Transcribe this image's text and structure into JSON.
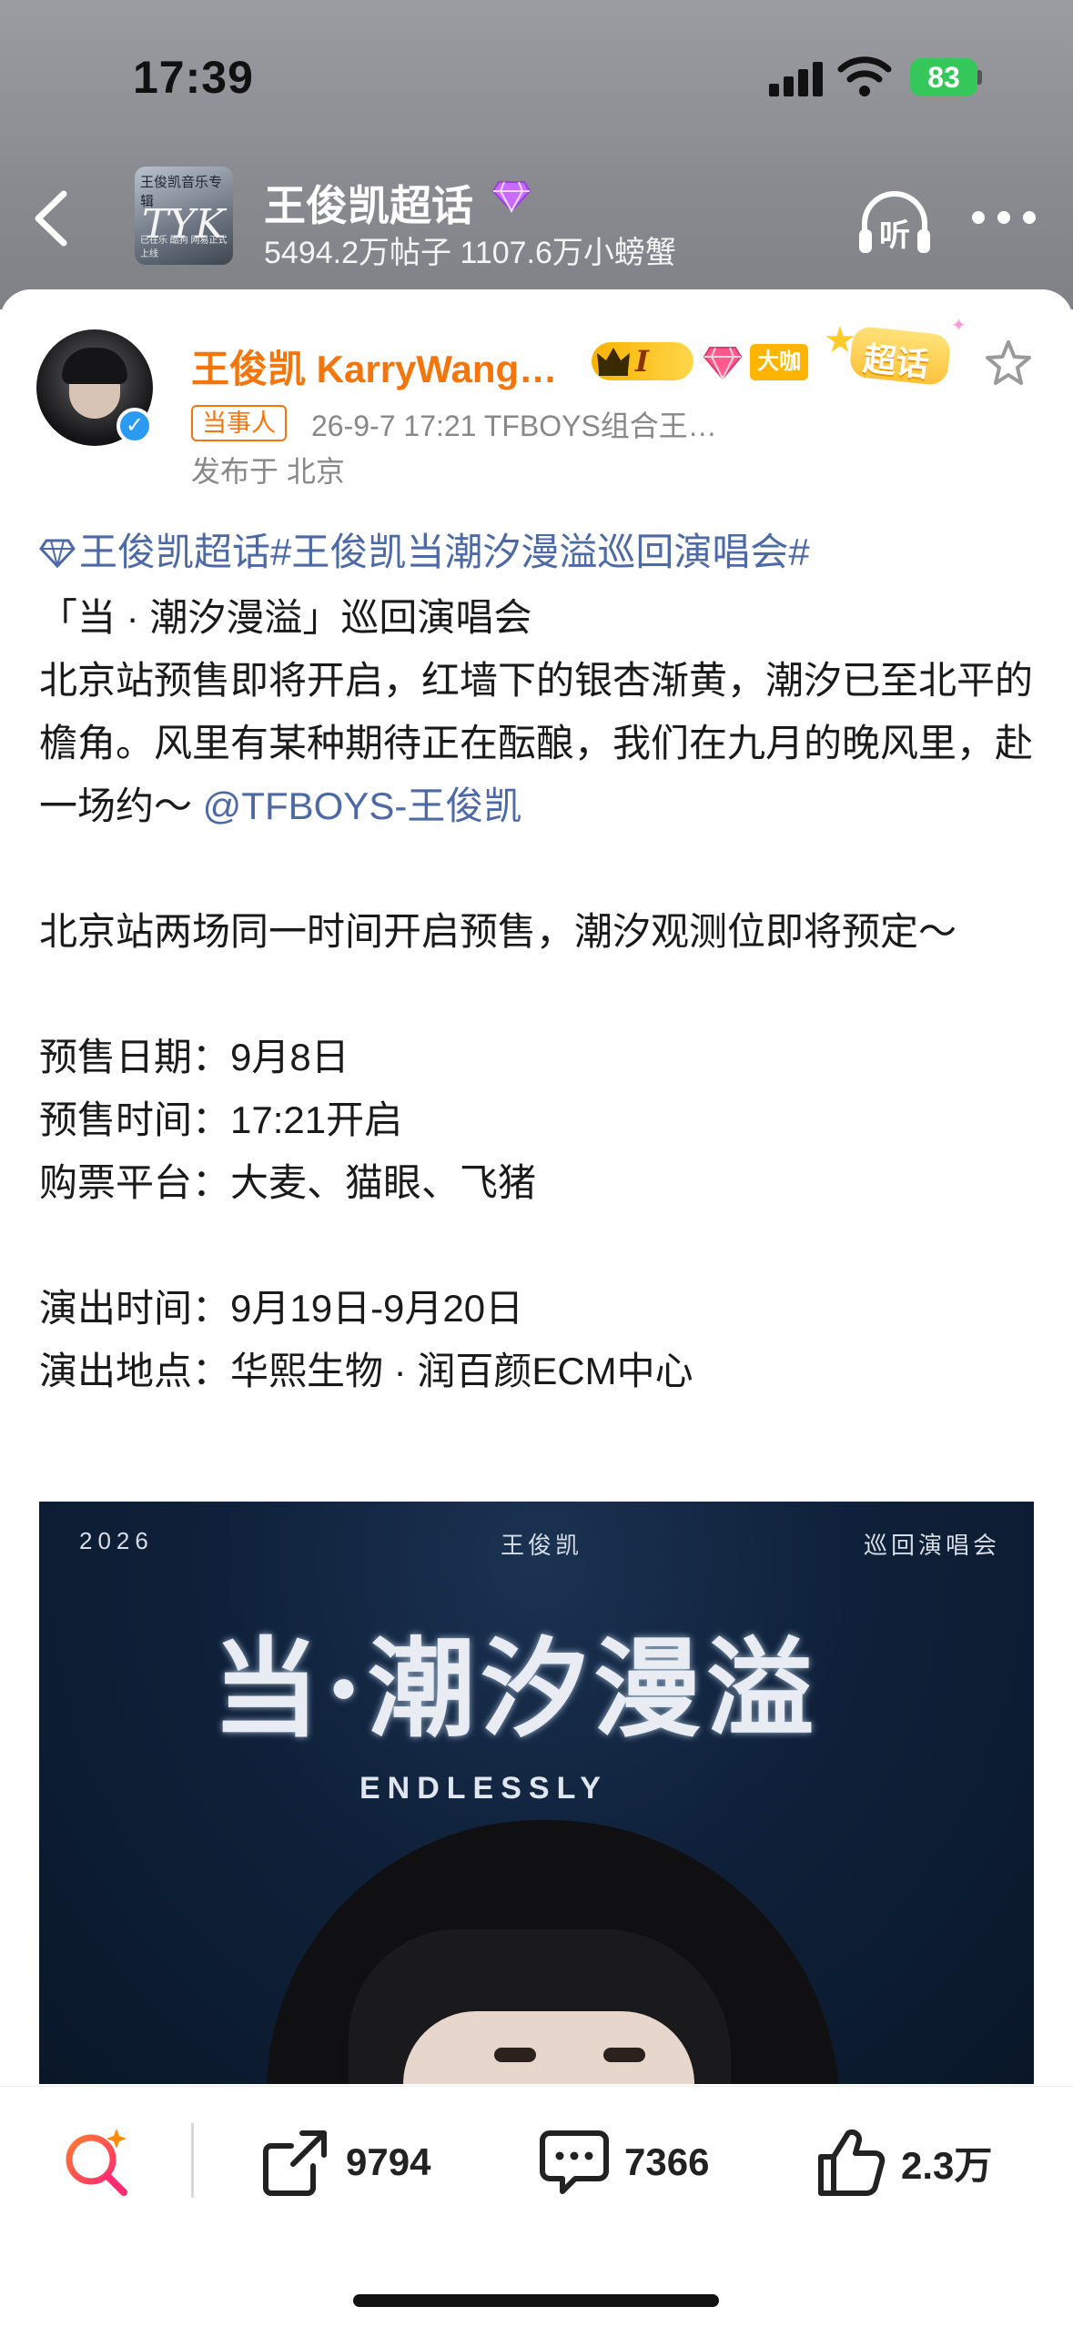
{
  "status_bar": {
    "time": "17:39",
    "battery": "83"
  },
  "header": {
    "topic_title": "王俊凯超话",
    "topic_stats": "5494.2万帖子 1107.6万小螃蟹",
    "listen_label": "听",
    "thumb_text_top": "王俊凯音乐专辑",
    "thumb_logo": "TYK",
    "thumb_text_bottom": "已在乐 酷狗 网易正式上线"
  },
  "post": {
    "author": "王俊凯 KarryWang…",
    "crown_level": "I",
    "badge_text": "大咖",
    "supertopic_badge": "超话",
    "role_tag": "当事人",
    "meta": "26-9-7 17:21  TFBOYS组合王…",
    "location": "发布于 北京",
    "hashtags": "王俊凯超话#王俊凯当潮汐漫溢巡回演唱会#",
    "line_title": "「当 · 潮汐漫溢」巡回演唱会",
    "para1": "北京站预售即将开启，红墙下的银杏渐黄，潮汐已至北平的檐角。风里有某种期待正在酝酿，我们在九月的晚风里，赴一场约～ ",
    "mention": "@TFBOYS-王俊凯",
    "para2": "北京站两场同一时间开启预售，潮汐观测位即将预定～",
    "presale_date": "预售日期：9月8日",
    "presale_time": "预售时间：17:21开启",
    "platform": "购票平台：大麦、猫眼、飞猪",
    "show_time": "演出时间：9月19日-9月20日",
    "venue": "演出地点：华熙生物 · 润百颜ECM中心"
  },
  "poster": {
    "year": "2026",
    "artist": "王俊凯",
    "tour": "巡回演唱会",
    "title": "当·潮汐漫溢",
    "subtitle": "ENDLESSLY"
  },
  "actions": {
    "share_count": "9794",
    "comment_count": "7366",
    "like_count": "2.3万"
  },
  "colors": {
    "accent_orange": "#f4750c",
    "link_blue": "#4d6aa6",
    "gold": "#ffb400"
  }
}
